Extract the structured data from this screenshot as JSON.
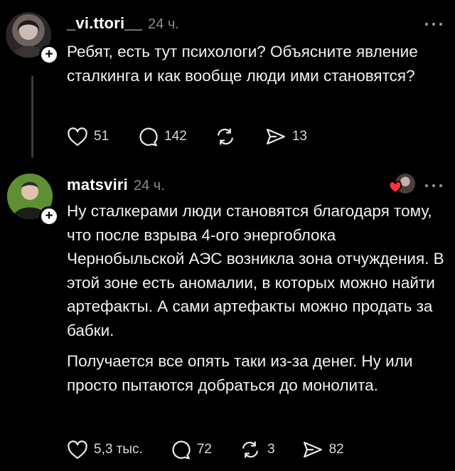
{
  "thread": {
    "post1": {
      "username": "_vi.ttori__",
      "time": "24 ч.",
      "text": "Ребят, есть тут психологи? Объясните явление сталкинга и как вообще люди ими становятся?",
      "stats": {
        "likes": "51",
        "comments": "142",
        "reposts": "",
        "shares": "13"
      }
    },
    "post2": {
      "username": "matsviri",
      "time": "24 ч.",
      "paragraphs": [
        "Ну сталкерами люди становятся благодаря тому, что после взрыва 4-ого энергоблока Чернобыльской АЭС возникла зона отчуждения. В этой зоне есть аномалии, в которых можно найти артефакты. А сами артефакты можно продать за бабки.",
        "Получается все опять таки из-за денег. Ну или просто пытаются добраться до монолита."
      ],
      "stats": {
        "likes": "5,3 тыс.",
        "comments": "72",
        "reposts": "3",
        "shares": "82"
      }
    }
  },
  "icons": {
    "avatar": "avatar",
    "follow": "plus-icon",
    "more": "more-horizontal-icon",
    "like": "heart-icon",
    "comment": "comment-icon",
    "repost": "repost-icon",
    "share": "share-icon"
  },
  "colors": {
    "background": "#000000",
    "text": "#f2f2f2",
    "muted": "#8a8a8a",
    "liked_heart": "#ff3040"
  }
}
